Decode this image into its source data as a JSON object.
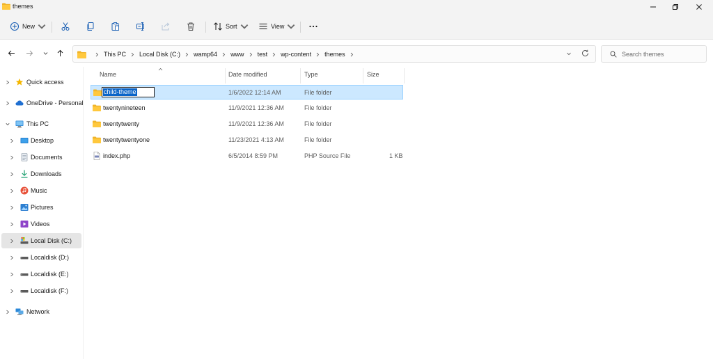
{
  "window": {
    "title": "themes",
    "minimize_icon": "minimize-icon",
    "maximize_icon": "restore-icon",
    "close_icon": "close-icon"
  },
  "toolbar": {
    "new_label": "New",
    "sort_label": "Sort",
    "view_label": "View",
    "icons": [
      "new-icon",
      "cut-icon",
      "copy-icon",
      "paste-icon",
      "rename-icon",
      "share-icon",
      "delete-icon",
      "sort-icon",
      "view-icon",
      "more-icon"
    ]
  },
  "address": {
    "crumbs": [
      "This PC",
      "Local Disk (C:)",
      "wamp64",
      "www",
      "test",
      "wp-content",
      "themes"
    ]
  },
  "search": {
    "placeholder": "Search themes",
    "value": ""
  },
  "sidebar": {
    "items": [
      {
        "label": "Quick access",
        "icon": "star-icon",
        "expanded": false
      },
      {
        "label": "OneDrive - Personal",
        "icon": "cloud-icon",
        "expanded": false
      },
      {
        "label": "This PC",
        "icon": "computer-icon",
        "expanded": true
      },
      {
        "label": "Desktop",
        "icon": "desktop-icon",
        "expanded": false
      },
      {
        "label": "Documents",
        "icon": "documents-icon",
        "expanded": false
      },
      {
        "label": "Downloads",
        "icon": "download-icon",
        "expanded": false
      },
      {
        "label": "Music",
        "icon": "music-icon",
        "expanded": false
      },
      {
        "label": "Pictures",
        "icon": "pictures-icon",
        "expanded": false
      },
      {
        "label": "Videos",
        "icon": "videos-icon",
        "expanded": false
      },
      {
        "label": "Local Disk (C:)",
        "icon": "drive-icon",
        "expanded": false,
        "selected": true
      },
      {
        "label": "Localdisk (D:)",
        "icon": "drive-icon",
        "expanded": false
      },
      {
        "label": "Localdisk (E:)",
        "icon": "drive-icon",
        "expanded": false
      },
      {
        "label": "Localdisk (F:)",
        "icon": "drive-icon",
        "expanded": false
      },
      {
        "label": "Network",
        "icon": "network-icon",
        "expanded": false
      }
    ]
  },
  "file_list": {
    "columns": [
      "Name",
      "Date modified",
      "Type",
      "Size"
    ],
    "rows": [
      {
        "name": "child-theme",
        "date": "1/6/2022 12:14 AM",
        "type": "File folder",
        "size": "",
        "icon": "folder-icon",
        "selected": true,
        "renaming": true
      },
      {
        "name": "twentynineteen",
        "date": "11/9/2021 12:36 AM",
        "type": "File folder",
        "size": "",
        "icon": "folder-icon"
      },
      {
        "name": "twentytwenty",
        "date": "11/9/2021 12:36 AM",
        "type": "File folder",
        "size": "",
        "icon": "folder-icon"
      },
      {
        "name": "twentytwentyone",
        "date": "11/23/2021 4:13 AM",
        "type": "File folder",
        "size": "",
        "icon": "folder-icon"
      },
      {
        "name": "index.php",
        "date": "6/5/2014 8:59 PM",
        "type": "PHP Source File",
        "size": "1 KB",
        "icon": "php-file-icon"
      }
    ]
  },
  "colors": {
    "folder": "#f0b429",
    "selection_bg": "#cce8ff",
    "selection_border": "#99d1ff",
    "rename_highlight": "#0a64c8",
    "chrome_bg": "#f3f3f3"
  }
}
